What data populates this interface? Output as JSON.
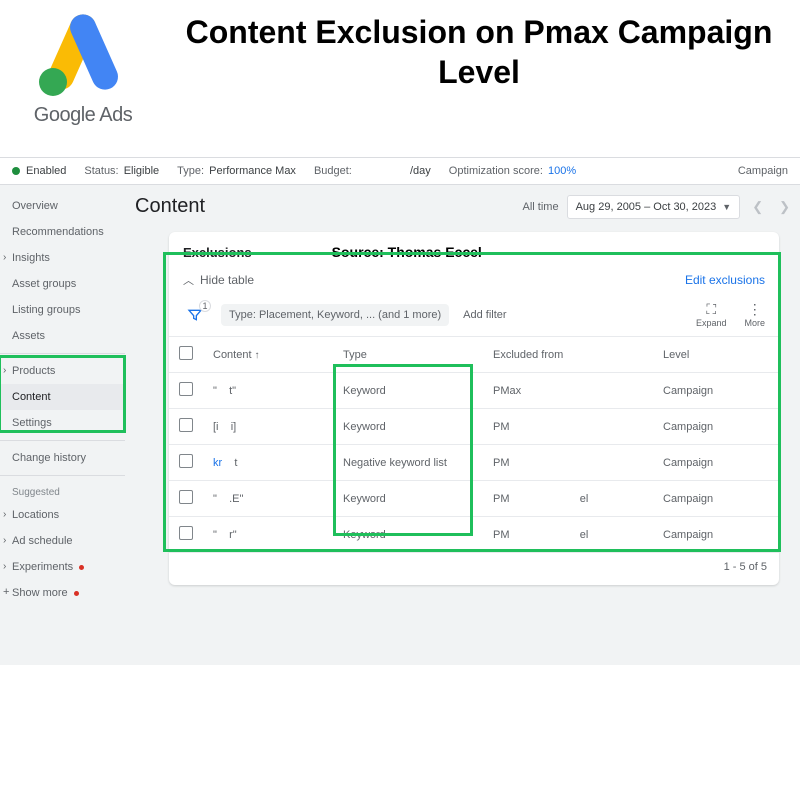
{
  "logo_text": "Google Ads",
  "page_title": "Content Exclusion on Pmax Campaign Level",
  "status_bar": {
    "enabled_label": "Enabled",
    "status_label": "Status:",
    "status_value": "Eligible",
    "type_label": "Type:",
    "type_value": "Performance Max",
    "budget_label": "Budget:",
    "budget_value": "/day",
    "opt_label": "Optimization score:",
    "opt_value": "100%",
    "right_label": "Campaign"
  },
  "sidebar": {
    "items": [
      {
        "label": "Overview"
      },
      {
        "label": "Recommendations"
      },
      {
        "label": "Insights",
        "caret": true
      },
      {
        "label": "Asset groups"
      },
      {
        "label": "Listing groups"
      },
      {
        "label": "Assets"
      },
      {
        "label": "Products",
        "caret": true
      },
      {
        "label": "Content",
        "active": true
      },
      {
        "label": "Settings"
      },
      {
        "label": "Change history"
      }
    ],
    "suggested_label": "Suggested",
    "suggested": [
      {
        "label": "Locations",
        "caret": true
      },
      {
        "label": "Ad schedule",
        "caret": true
      },
      {
        "label": "Experiments",
        "caret": true,
        "dot": true
      },
      {
        "label": "Show more",
        "plus": true,
        "dot": true
      }
    ]
  },
  "content": {
    "title": "Content",
    "all_time": "All time",
    "date_range": "Aug 29, 2005 – Oct 30, 2023"
  },
  "card": {
    "title": "Exclusions",
    "source": "Source: Thomas Eccel",
    "hide_label": "Hide table",
    "edit_label": "Edit exclusions",
    "filter_chip": "Type: Placement, Keyword, ... (and 1 more)",
    "filter_badge": "1",
    "add_filter": "Add filter",
    "tools": {
      "expand": "Expand",
      "more": "More"
    },
    "columns": {
      "content": "Content",
      "type": "Type",
      "excluded": "Excluded from",
      "level": "Level"
    },
    "rows": [
      {
        "content": "\"",
        "content2": "t\"",
        "type": "Keyword",
        "excluded": "PMax",
        "level": "Campaign"
      },
      {
        "content": "[i",
        "content2": "i]",
        "type": "Keyword",
        "excluded": "PM",
        "level": "Campaign"
      },
      {
        "content": "kr",
        "content2": "t",
        "type": "Negative keyword list",
        "excluded": "PM",
        "level": "Campaign",
        "link": true
      },
      {
        "content": "\"",
        "content2": ".E\"",
        "type": "Keyword",
        "excluded": "PM                       el",
        "level": "Campaign"
      },
      {
        "content": "\"",
        "content2": "r\"",
        "type": "Keyword",
        "excluded": "PM                       el",
        "level": "Campaign"
      }
    ],
    "pager": "1 - 5 of 5"
  }
}
